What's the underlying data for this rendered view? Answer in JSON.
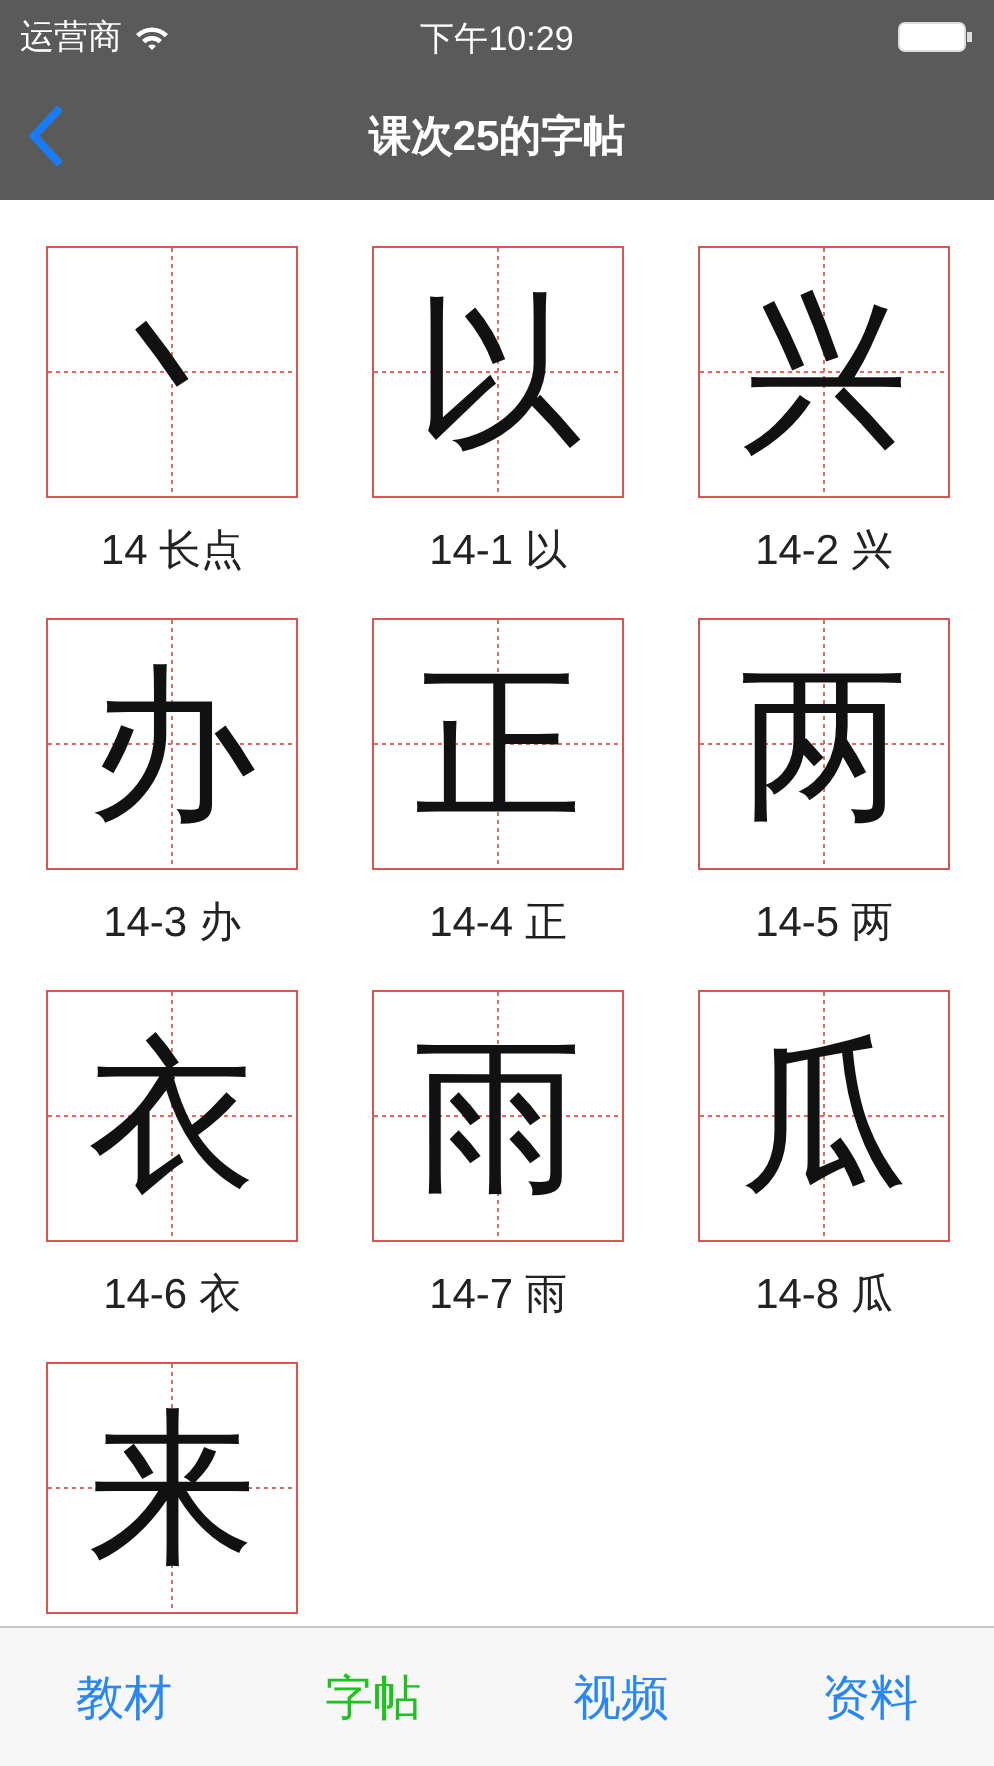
{
  "status_bar": {
    "carrier": "运营商",
    "time": "下午10:29"
  },
  "nav": {
    "title": "课次25的字帖"
  },
  "items": [
    {
      "glyph": "丶",
      "label": "14 长点"
    },
    {
      "glyph": "以",
      "label": "14-1 以"
    },
    {
      "glyph": "兴",
      "label": "14-2 兴"
    },
    {
      "glyph": "办",
      "label": "14-3 办"
    },
    {
      "glyph": "正",
      "label": "14-4 正"
    },
    {
      "glyph": "两",
      "label": "14-5 两"
    },
    {
      "glyph": "衣",
      "label": "14-6 衣"
    },
    {
      "glyph": "雨",
      "label": "14-7 雨"
    },
    {
      "glyph": "瓜",
      "label": "14-8 瓜"
    },
    {
      "glyph": "来"
    }
  ],
  "tabs": [
    {
      "label": "教材",
      "selected": false
    },
    {
      "label": "字帖",
      "selected": true
    },
    {
      "label": "视频",
      "selected": false
    },
    {
      "label": "资料",
      "selected": false
    }
  ]
}
